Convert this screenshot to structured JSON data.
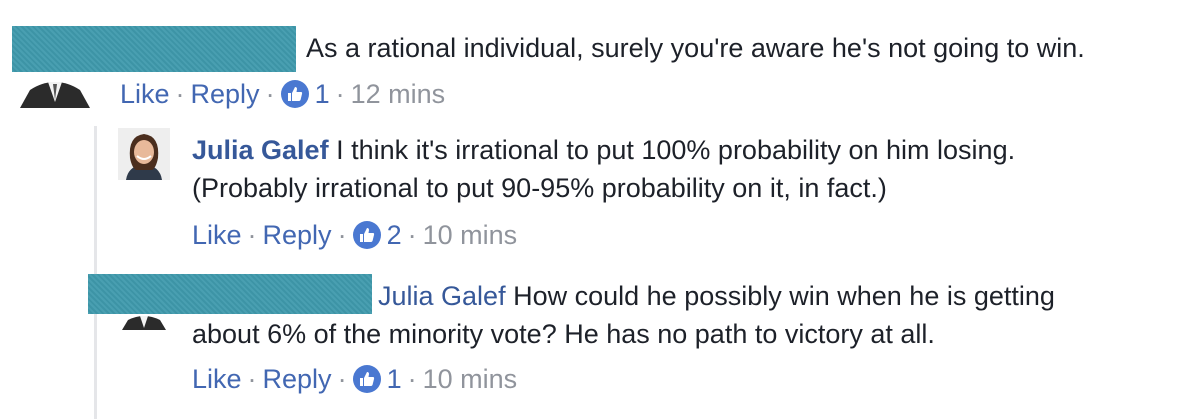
{
  "comment1": {
    "text": "As a rational individual, surely you're aware he's not going to win.",
    "actions": {
      "like": "Like",
      "reply": "Reply",
      "reaction_count": "1",
      "time": "12 mins"
    }
  },
  "reply1": {
    "author": "Julia Galef",
    "line1": "I think it's irrational to put 100% probability on him losing.",
    "line2": "(Probably irrational to put 90-95% probability on it, in fact.)",
    "actions": {
      "like": "Like",
      "reply": "Reply",
      "reaction_count": "2",
      "time": "10 mins"
    }
  },
  "reply2": {
    "mention": "Julia Galef",
    "line1": "How could he possibly win when he is getting",
    "line2": "about 6% of the minority vote? He has no path to victory at all.",
    "actions": {
      "like": "Like",
      "reply": "Reply",
      "reaction_count": "1",
      "time": "10 mins"
    }
  },
  "separator": "·",
  "colors": {
    "redaction": "#3f9aad",
    "link": "#4267b2",
    "name": "#365899",
    "meta": "#90949c",
    "text": "#1d2129",
    "like_badge": "#4a78d1"
  },
  "icons": [
    "thumbs-up-icon",
    "avatar-icon"
  ]
}
